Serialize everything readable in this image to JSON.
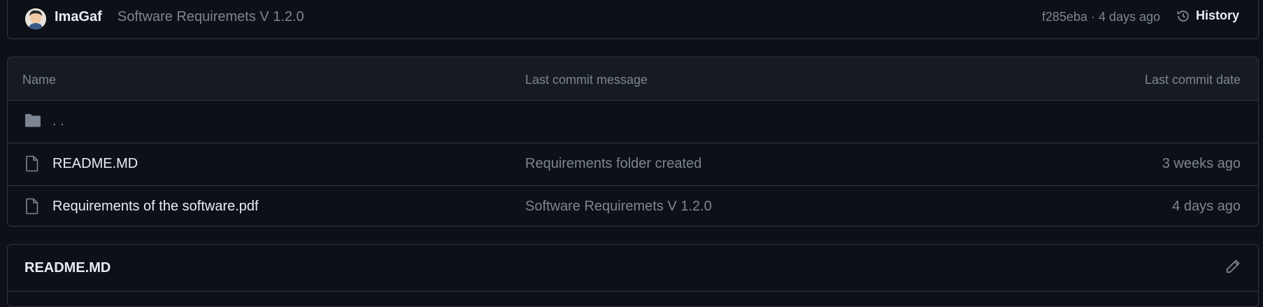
{
  "commit": {
    "author": "ImaGaf",
    "message": "Software Requiremets V 1.2.0",
    "sha_time": "f285eba · 4 days ago",
    "history_label": "History"
  },
  "table": {
    "headers": {
      "name": "Name",
      "message": "Last commit message",
      "date": "Last commit date"
    },
    "parent": {
      "name": ". ."
    },
    "rows": [
      {
        "name": "README.MD",
        "message": "Requirements folder created",
        "date": "3 weeks ago"
      },
      {
        "name": "Requirements of the software.pdf",
        "message": "Software Requiremets V 1.2.0",
        "date": "4 days ago"
      }
    ]
  },
  "readme": {
    "title": "README.MD"
  },
  "icons": {
    "avatar": "avatar",
    "history": "history-clock-icon",
    "folder": "folder-icon",
    "file": "file-icon",
    "edit": "pencil-icon"
  }
}
